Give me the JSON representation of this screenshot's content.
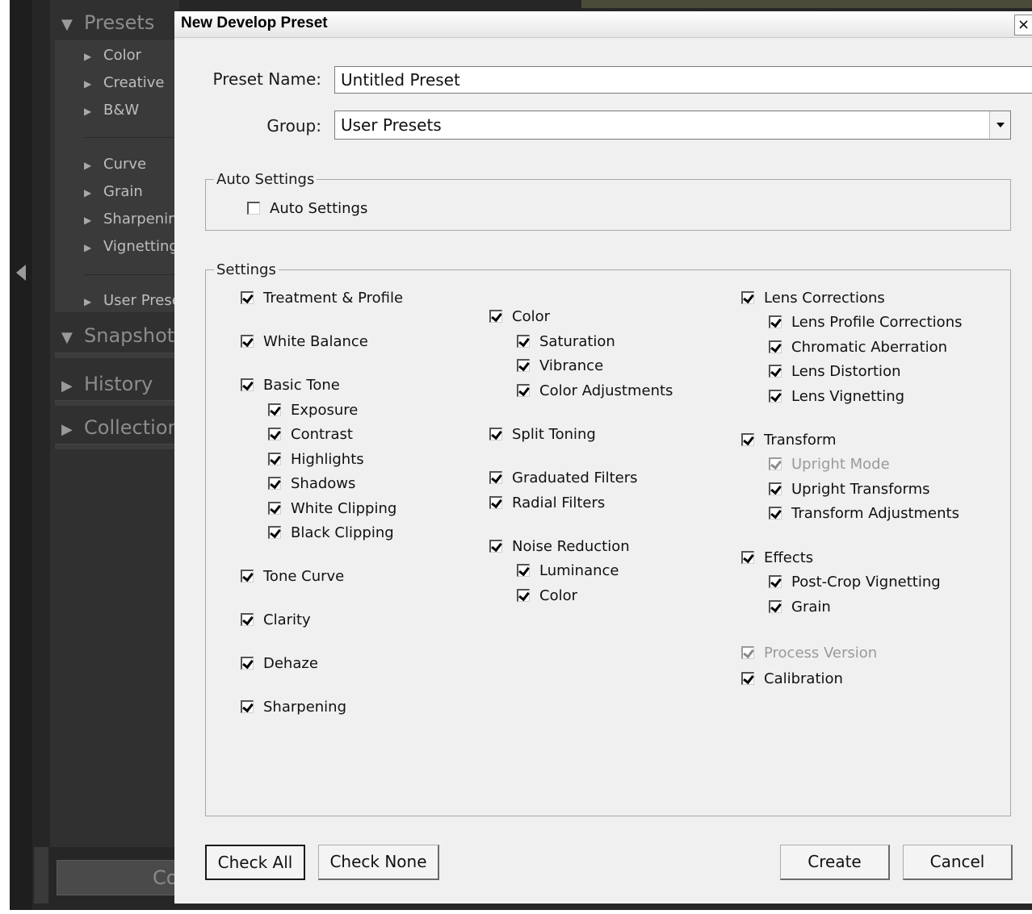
{
  "app": {
    "panels": {
      "presets": "Presets",
      "preset_items": [
        "Color",
        "Creative",
        "B&W",
        "Curve",
        "Grain",
        "Sharpening",
        "Vignetting",
        "User Presets"
      ],
      "snapshots": "Snapshots",
      "history": "History",
      "collections": "Collections",
      "bottom_button": "Copy..."
    }
  },
  "dialog": {
    "title": "New Develop Preset",
    "close_glyph": "×",
    "preset_name_label": "Preset Name:",
    "preset_name_value": "Untitled Preset",
    "group_label": "Group:",
    "group_value": "User Presets",
    "auto_settings_legend": "Auto Settings",
    "auto_settings_checkbox": "Auto Settings",
    "settings_legend": "Settings",
    "columns": {
      "col1": {
        "treatment_profile": "Treatment & Profile",
        "white_balance": "White Balance",
        "basic_tone": "Basic Tone",
        "exposure": "Exposure",
        "contrast": "Contrast",
        "highlights": "Highlights",
        "shadows": "Shadows",
        "white_clipping": "White Clipping",
        "black_clipping": "Black Clipping",
        "tone_curve": "Tone Curve",
        "clarity": "Clarity",
        "dehaze": "Dehaze",
        "sharpening": "Sharpening"
      },
      "col2": {
        "color": "Color",
        "saturation": "Saturation",
        "vibrance": "Vibrance",
        "color_adjustments": "Color Adjustments",
        "split_toning": "Split Toning",
        "graduated_filters": "Graduated Filters",
        "radial_filters": "Radial Filters",
        "noise_reduction": "Noise Reduction",
        "luminance": "Luminance",
        "nr_color": "Color"
      },
      "col3": {
        "lens_corrections": "Lens Corrections",
        "lens_profile_corrections": "Lens Profile Corrections",
        "chromatic_aberration": "Chromatic Aberration",
        "lens_distortion": "Lens Distortion",
        "lens_vignetting": "Lens Vignetting",
        "transform": "Transform",
        "upright_mode": "Upright Mode",
        "upright_transforms": "Upright Transforms",
        "transform_adjustments": "Transform Adjustments",
        "effects": "Effects",
        "post_crop_vignetting": "Post-Crop Vignetting",
        "grain": "Grain",
        "process_version": "Process Version",
        "calibration": "Calibration"
      }
    },
    "buttons": {
      "check_all": "Check All",
      "check_none": "Check None",
      "create": "Create",
      "cancel": "Cancel"
    }
  }
}
